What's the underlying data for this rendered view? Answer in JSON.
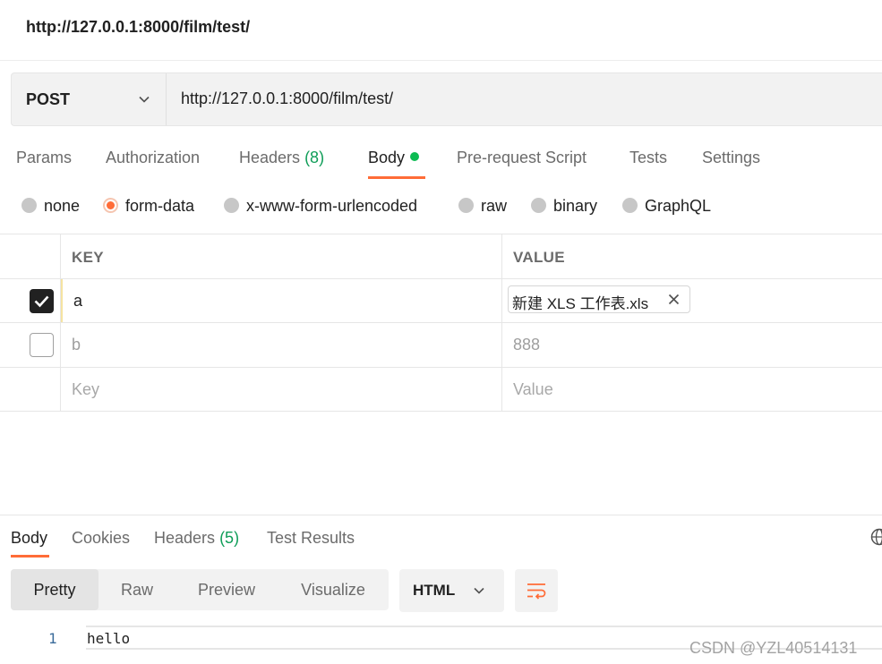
{
  "window": {
    "title": "http://127.0.0.1:8000/film/test/"
  },
  "request": {
    "method": "POST",
    "url": "http://127.0.0.1:8000/film/test/",
    "tabs": [
      {
        "label": "Params"
      },
      {
        "label": "Authorization"
      },
      {
        "label": "Headers",
        "count": "(8)"
      },
      {
        "label": "Body",
        "active": true
      },
      {
        "label": "Pre-request Script"
      },
      {
        "label": "Tests"
      },
      {
        "label": "Settings"
      }
    ],
    "body_types": [
      {
        "label": "none"
      },
      {
        "label": "form-data",
        "selected": true
      },
      {
        "label": "x-www-form-urlencoded"
      },
      {
        "label": "raw"
      },
      {
        "label": "binary"
      },
      {
        "label": "GraphQL"
      }
    ],
    "table": {
      "headers": {
        "key": "KEY",
        "value": "VALUE"
      },
      "rows": [
        {
          "checked": true,
          "key": "a",
          "value": "新建 XLS 工作表.xls"
        },
        {
          "checked": false,
          "key": "b",
          "value": "888"
        }
      ],
      "placeholder": {
        "key": "Key",
        "value": "Value"
      }
    }
  },
  "response": {
    "tabs": [
      {
        "label": "Body",
        "active": true
      },
      {
        "label": "Cookies"
      },
      {
        "label": "Headers",
        "count": "(5)"
      },
      {
        "label": "Test Results"
      }
    ],
    "views": [
      "Pretty",
      "Raw",
      "Preview",
      "Visualize"
    ],
    "active_view": "Pretty",
    "format": "HTML",
    "lines": [
      {
        "no": "1",
        "text": "hello"
      }
    ]
  },
  "watermark": "CSDN @YZL40514131",
  "colors": {
    "accent": "#ff6c37",
    "count_green": "#0f9d58",
    "status_dot": "#0cbb52"
  }
}
